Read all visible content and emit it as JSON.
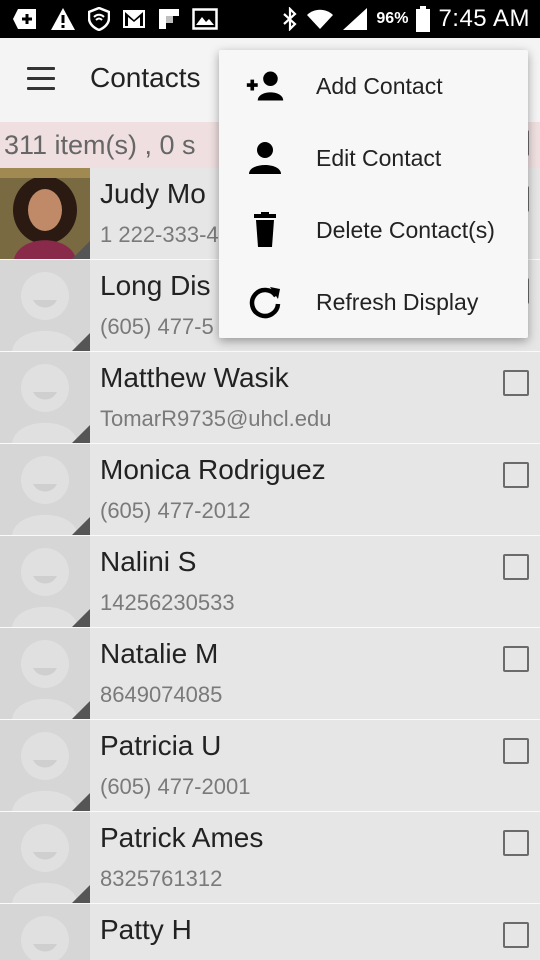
{
  "status_bar": {
    "icons_left": [
      "add-notification-icon",
      "warning-icon",
      "shield-icon",
      "gmail-icon",
      "flipboard-icon",
      "image-icon"
    ],
    "icons_right": [
      "bluetooth-icon",
      "wifi-icon",
      "signal-icon"
    ],
    "battery_percent": "96%",
    "time": "7:45 AM"
  },
  "app_bar": {
    "title": "Contacts"
  },
  "count_bar": {
    "text": "311 item(s) , 0 s"
  },
  "contacts": [
    {
      "name": "Judy Mo",
      "detail": "1 222-333-4",
      "photo": true
    },
    {
      "name": "Long Dis",
      "detail": "(605) 477-5",
      "photo": false
    },
    {
      "name": "Matthew Wasik",
      "detail": "TomarR9735@uhcl.edu",
      "photo": false
    },
    {
      "name": "Monica Rodriguez",
      "detail": "(605) 477-2012",
      "photo": false
    },
    {
      "name": "Nalini S",
      "detail": "14256230533",
      "photo": false
    },
    {
      "name": "Natalie M",
      "detail": "8649074085",
      "photo": false
    },
    {
      "name": "Patricia U",
      "detail": "(605) 477-2001",
      "photo": false
    },
    {
      "name": "Patrick Ames",
      "detail": "8325761312",
      "photo": false
    },
    {
      "name": "Patty H",
      "detail": "",
      "photo": false
    }
  ],
  "menu": {
    "items": [
      {
        "label": "Add Contact",
        "icon": "add-person-icon"
      },
      {
        "label": "Edit Contact",
        "icon": "person-icon"
      },
      {
        "label": "Delete Contact(s)",
        "icon": "trash-icon"
      },
      {
        "label": "Refresh Display",
        "icon": "refresh-icon"
      }
    ]
  },
  "colors": {
    "status_bar": "#000000",
    "app_bar": "#f4f4f4",
    "count_bar": "#efdfe0",
    "list_bg": "#e6e6e6",
    "menu_bg": "#f7f7f7"
  }
}
